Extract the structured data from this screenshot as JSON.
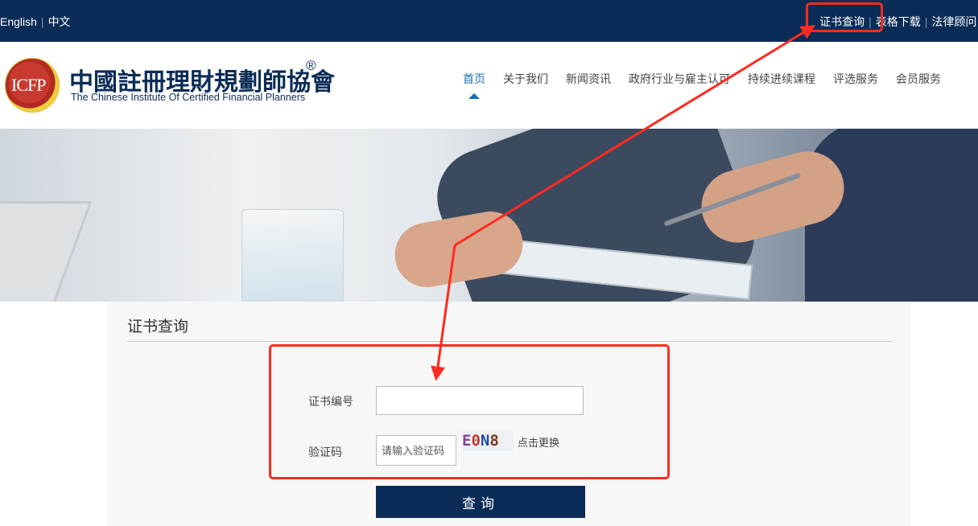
{
  "topbar": {
    "lang_en": "English",
    "lang_cn": "中文",
    "links": [
      "证书查询",
      "表格下载",
      "法律顾问"
    ]
  },
  "header": {
    "logo_text": "ICFP",
    "org_cn": "中國註冊理財規劃師協會",
    "org_reg": "®",
    "org_en": "The Chinese Institute Of Certified Financial Planners"
  },
  "nav": {
    "items": [
      "首页",
      "关于我们",
      "新闻资讯",
      "政府行业与雇主认可",
      "持续进续课程",
      "评选服务",
      "会员服务"
    ],
    "active_index": 0
  },
  "query": {
    "title": "证书查询",
    "cert_label": "证书编号",
    "cert_value": "",
    "captcha_label": "验证码",
    "captcha_placeholder": "请输入验证码",
    "captcha_chars": [
      "E",
      "0",
      "N",
      "8"
    ],
    "captcha_colors": [
      "#8a3fa0",
      "#c0392b",
      "#1f4fa8",
      "#7a3b1a"
    ],
    "refresh_label": "点击更换",
    "button_label": "查询"
  },
  "colors": {
    "brand_navy": "#0b2c57",
    "accent_blue": "#1a6bb5",
    "annotation_red": "#ff2a1f"
  }
}
